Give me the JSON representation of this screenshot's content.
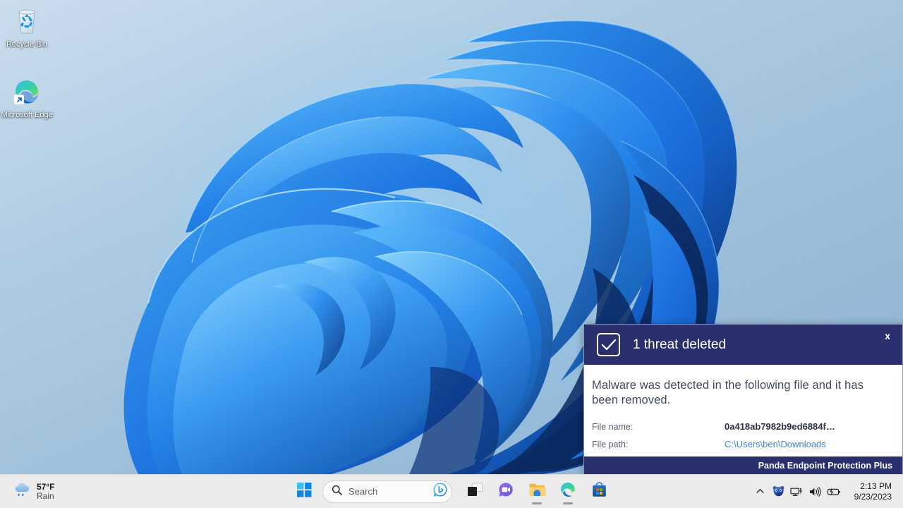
{
  "desktop": {
    "icons": [
      {
        "name": "Recycle Bin",
        "icon": "recycle-bin-icon"
      },
      {
        "name": "Microsoft Edge",
        "icon": "microsoft-edge-icon"
      }
    ]
  },
  "notification": {
    "title": "1 threat deleted",
    "close_label": "x",
    "header_icon": "checkmark-box-icon",
    "message": "Malware was detected in the following file and it has been removed.",
    "details": [
      {
        "label": "File name:",
        "value": "0a418ab7982b9ed6884f…",
        "type": "file"
      },
      {
        "label": "File path:",
        "value": "C:\\Users\\ben\\Downloads",
        "type": "path"
      }
    ],
    "brand": "Panda Endpoint Protection Plus",
    "colors": {
      "header_bg": "#2a306e",
      "body_bg": "#ffffff",
      "link": "#3d7fe0"
    }
  },
  "taskbar": {
    "weather": {
      "temperature": "57°F",
      "condition": "Rain",
      "icon": "rain-cloud-icon"
    },
    "start": {
      "label": "Start",
      "icon": "windows-logo-icon"
    },
    "search": {
      "placeholder": "Search",
      "icon": "search-icon",
      "assistant_icon": "bing-chat-icon"
    },
    "apps": [
      {
        "name": "Task View",
        "icon": "task-view-icon",
        "running": false
      },
      {
        "name": "Chat",
        "icon": "chat-icon",
        "running": false
      },
      {
        "name": "File Explorer",
        "icon": "file-explorer-icon",
        "running": true
      },
      {
        "name": "Microsoft Edge",
        "icon": "microsoft-edge-icon",
        "running": true
      },
      {
        "name": "Microsoft Store",
        "icon": "microsoft-store-icon",
        "running": false
      }
    ],
    "tray": [
      {
        "name": "Show hidden icons",
        "icon": "chevron-up-icon"
      },
      {
        "name": "Panda Security",
        "icon": "panda-shield-icon"
      },
      {
        "name": "Network",
        "icon": "network-icon"
      },
      {
        "name": "Volume",
        "icon": "speaker-icon"
      },
      {
        "name": "Battery",
        "icon": "battery-icon"
      }
    ],
    "clock": {
      "time": "2:13 PM",
      "date": "9/23/2023"
    }
  }
}
